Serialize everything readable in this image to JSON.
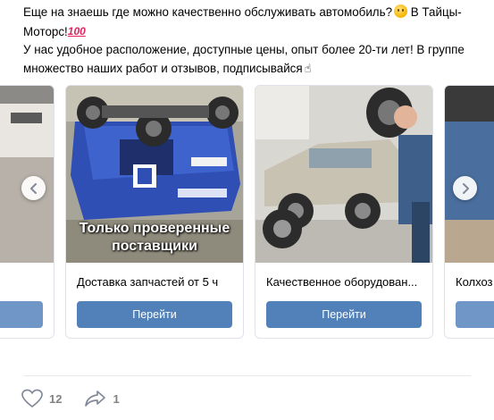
{
  "post": {
    "line1": "Еще на знаешь где можно качественно обслуживать автомобиль?",
    "line1_tail": " В Тайцы-Моторс!",
    "emoji_100": "100",
    "line2": "У нас удобное расположение, доступные цены, опыт более 20-ти лет! В группе множество наших работ и отзывов, подписывайся"
  },
  "carousel": {
    "cards": [
      {
        "title": "",
        "button": ""
      },
      {
        "title": "Доставка запчастей от 5 ч",
        "button": "Перейти",
        "overlay_line1": "Только проверенные",
        "overlay_line2": "поставщики"
      },
      {
        "title": "Качественное оборудован...",
        "button": "Перейти"
      },
      {
        "title": "Колхоз",
        "button": ""
      }
    ]
  },
  "actions": {
    "likes": "12",
    "shares": "1"
  },
  "colors": {
    "accent": "#5181b8",
    "muted": "#828282"
  }
}
